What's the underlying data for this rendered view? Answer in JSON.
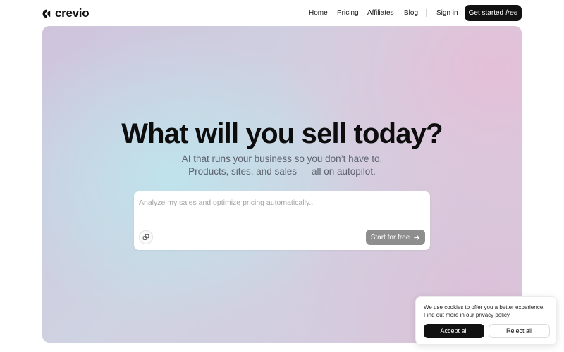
{
  "brand": {
    "name": "crevio",
    "icon": "crevio-logo-icon"
  },
  "nav": {
    "links": [
      "Home",
      "Pricing",
      "Affiliates",
      "Blog"
    ],
    "sign_in": "Sign in",
    "cta_label": "Get started",
    "cta_emphasis": "free"
  },
  "hero": {
    "headline": "What will you sell today?",
    "subline_1": "AI that runs your business so you don’t have to.",
    "subline_2": "Products, sites, and sales — all on autopilot.",
    "prompt_placeholder": "Analyze my sales and optimize pricing automatically..",
    "prompt_value": "",
    "attach_icon": "attachment-icon",
    "start_label": "Start for free",
    "start_icon": "arrow-right-icon"
  },
  "cookie": {
    "text_1": "We use cookies to offer you a better experience.",
    "text_2": "Find out more in our",
    "link": "privacy policy",
    "text_end": ".",
    "accept": "Accept all",
    "reject": "Reject all"
  },
  "colors": {
    "primary": "#111111",
    "start_button": "#8e8e8e",
    "gradient_teal": "#bee4ec",
    "gradient_pink": "#e6bed7"
  }
}
